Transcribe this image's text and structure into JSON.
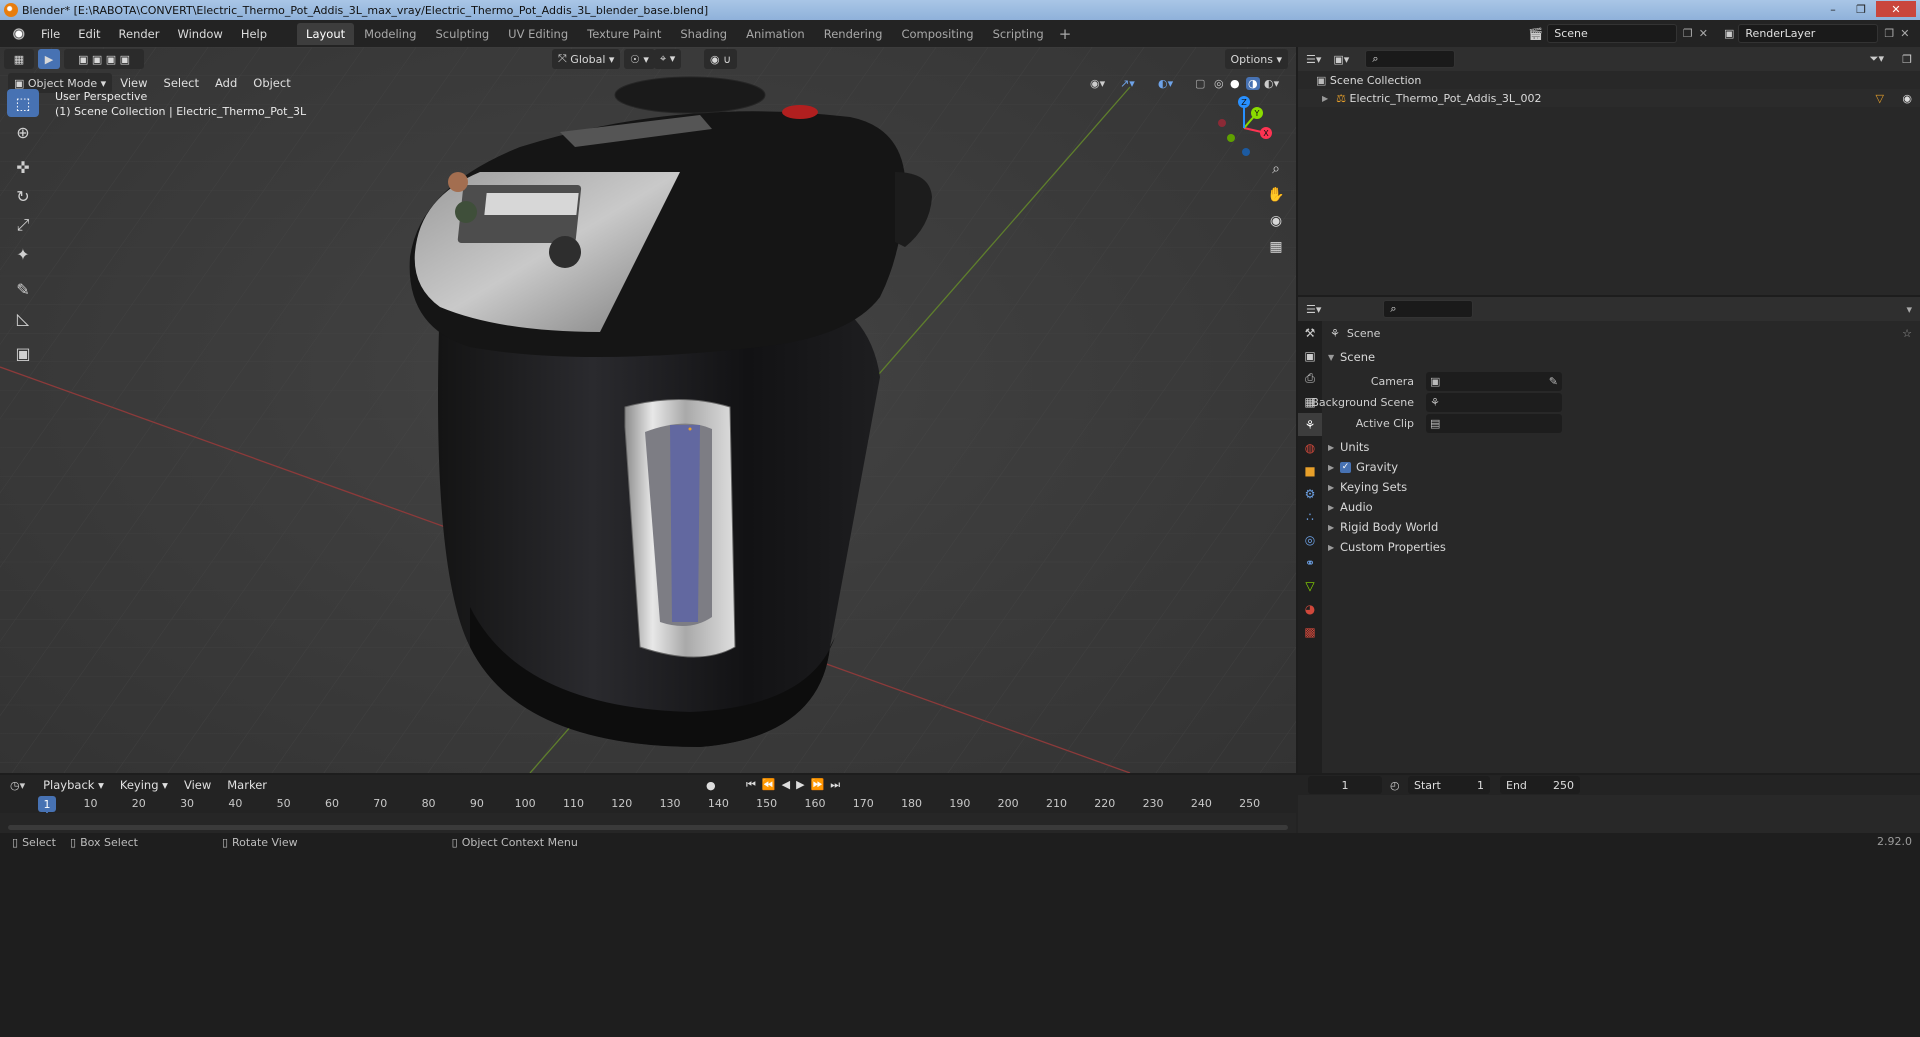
{
  "window": {
    "title": "Blender* [E:\\RABOTA\\CONVERT\\Electric_Thermo_Pot_Addis_3L_max_vray/Electric_Thermo_Pot_Addis_3L_blender_base.blend]",
    "controls": [
      "–",
      "❐",
      "✕"
    ]
  },
  "menu": [
    "File",
    "Edit",
    "Render",
    "Window",
    "Help"
  ],
  "workspaces": [
    {
      "label": "Layout",
      "active": true
    },
    {
      "label": "Modeling"
    },
    {
      "label": "Sculpting"
    },
    {
      "label": "UV Editing"
    },
    {
      "label": "Texture Paint"
    },
    {
      "label": "Shading"
    },
    {
      "label": "Animation"
    },
    {
      "label": "Rendering"
    },
    {
      "label": "Compositing"
    },
    {
      "label": "Scripting"
    }
  ],
  "top": {
    "scene": "Scene",
    "render_layer": "RenderLayer",
    "add": "+"
  },
  "viewport": {
    "transform_orientation": "Global",
    "options": "Options",
    "mode": "Object Mode",
    "menus": [
      "View",
      "Select",
      "Add",
      "Object"
    ],
    "overlay_line1": "User Perspective",
    "overlay_line2": "(1) Scene Collection | Electric_Thermo_Pot_3L",
    "gizmo_axes": {
      "x": "X",
      "y": "Y",
      "z": "Z"
    },
    "tools": [
      "select-box",
      "cursor",
      "move",
      "rotate",
      "scale",
      "transform",
      "annotate",
      "measure",
      "add-cube"
    ]
  },
  "outliner": {
    "root": "Scene Collection",
    "items": [
      "Electric_Thermo_Pot_Addis_3L_002"
    ]
  },
  "properties": {
    "context": "Scene",
    "panel": "Scene",
    "fields": [
      {
        "label": "Camera",
        "value": ""
      },
      {
        "label": "Background Scene",
        "value": ""
      },
      {
        "label": "Active Clip",
        "value": ""
      }
    ],
    "subpanels": [
      "Units",
      "Gravity",
      "Keying Sets",
      "Audio",
      "Rigid Body World",
      "Custom Properties"
    ],
    "gravity_checked": true
  },
  "timeline": {
    "menus": [
      "Playback",
      "Keying",
      "View",
      "Marker"
    ],
    "current_frame": "1",
    "start_label": "Start",
    "start": "1",
    "end_label": "End",
    "end": "250",
    "ruler": [
      "1",
      "10",
      "20",
      "30",
      "40",
      "50",
      "60",
      "70",
      "80",
      "90",
      "100",
      "110",
      "120",
      "130",
      "140",
      "150",
      "160",
      "170",
      "180",
      "190",
      "200",
      "210",
      "220",
      "230",
      "240",
      "250"
    ],
    "transport": [
      "⏮",
      "⏪",
      "◀",
      "▶",
      "⏩",
      "⏭"
    ]
  },
  "status": {
    "select": "Select",
    "box_select": "Box Select",
    "rotate": "Rotate View",
    "context_menu": "Object Context Menu",
    "version": "2.92.0"
  },
  "colors": {
    "accent": "#4772b3",
    "x_axis": "#ff3352",
    "y_axis": "#8bdc00",
    "z_axis": "#2890ff"
  }
}
